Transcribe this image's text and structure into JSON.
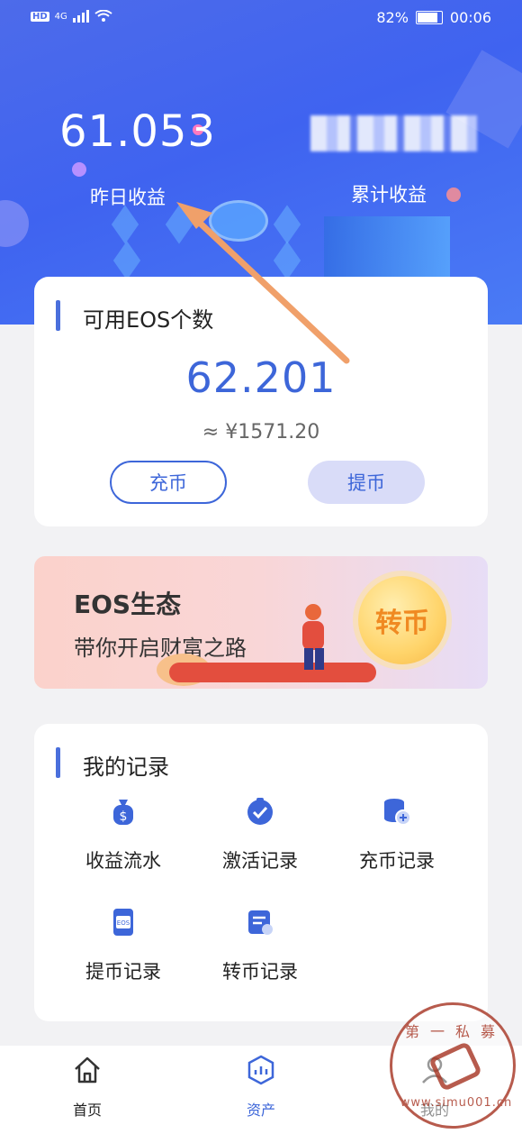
{
  "status_bar": {
    "left_badges": [
      "HD",
      "4G"
    ],
    "battery": "82%",
    "time": "00:06"
  },
  "header": {
    "yesterday_value": "61.053",
    "yesterday_label": "昨日收益",
    "total_label": "累计收益"
  },
  "eos_card": {
    "title": "可用EOS个数",
    "count": "62.201",
    "cny": "≈ ¥1571.20",
    "deposit_label": "充币",
    "withdraw_label": "提币"
  },
  "banner": {
    "title": "EOS生态",
    "subtitle": "带你开启财富之路",
    "coin_label": "转币"
  },
  "records": {
    "title": "我的记录",
    "items": [
      {
        "label": "收益流水",
        "icon": "money-bag-icon"
      },
      {
        "label": "激活记录",
        "icon": "check-badge-icon"
      },
      {
        "label": "充币记录",
        "icon": "coin-stack-plus-icon"
      },
      {
        "label": "提币记录",
        "icon": "eos-card-icon"
      },
      {
        "label": "转币记录",
        "icon": "transfer-doc-icon"
      }
    ]
  },
  "tabbar": {
    "items": [
      {
        "label": "首页",
        "icon": "home-icon",
        "active": false
      },
      {
        "label": "资产",
        "icon": "assets-icon",
        "active": true
      },
      {
        "label": "我的",
        "icon": "user-icon",
        "active": false
      }
    ]
  },
  "watermark": {
    "top": "第一私募",
    "bottom": "www.simu001.cn"
  },
  "colors": {
    "accent": "#3d66d9",
    "hero": "#4d6bea",
    "arrow": "#f0a06a",
    "stamp": "#b04a3a"
  }
}
